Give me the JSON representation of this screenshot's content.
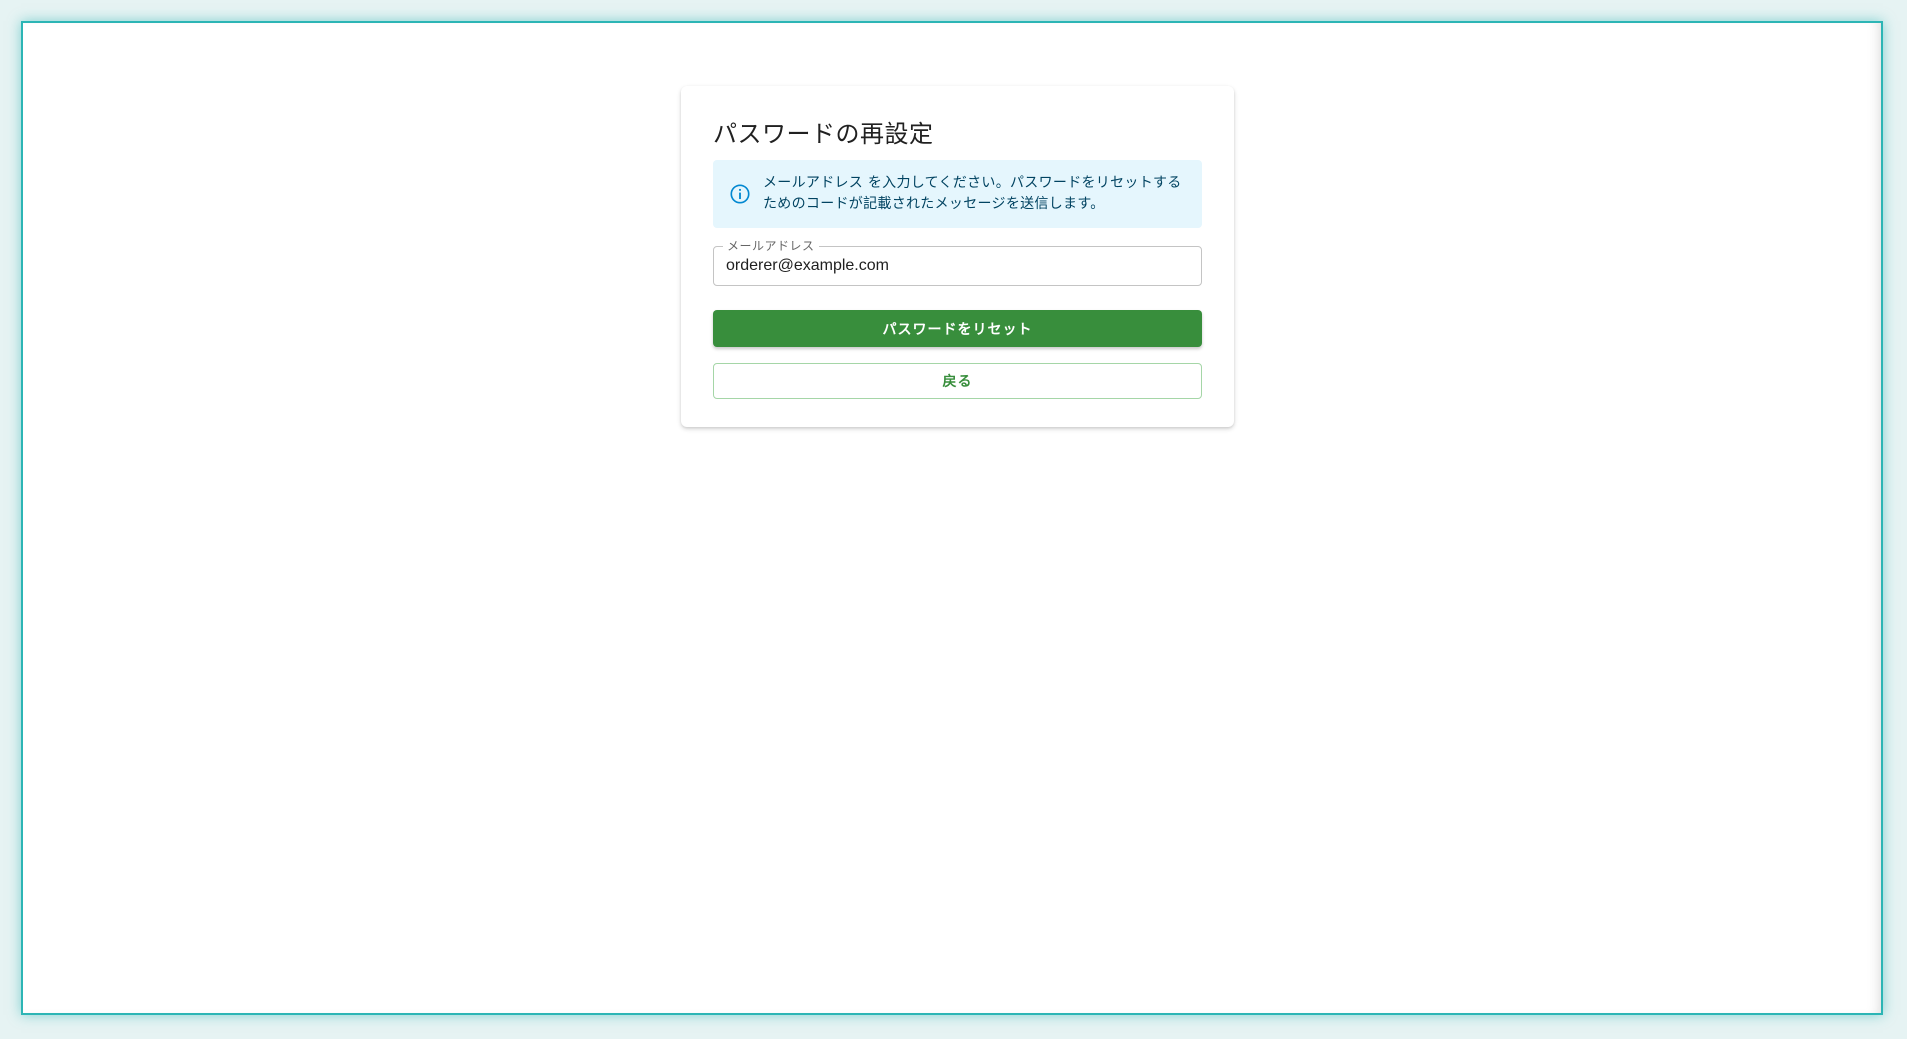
{
  "page": {
    "title": "パスワードの再設定"
  },
  "alert": {
    "icon": "info-icon",
    "message": "メールアドレス を入力してください。パスワードをリセットするためのコードが記載されたメッセージを送信します。"
  },
  "email_field": {
    "label": "メールアドレス",
    "value": "orderer@example.com"
  },
  "buttons": {
    "reset_label": "パスワードをリセット",
    "back_label": "戻る"
  },
  "colors": {
    "primary": "#388e3c",
    "alert_bg": "#e5f6fd",
    "alert_text": "#014361",
    "info_icon": "#0288d1",
    "frame_border": "#2cb5b5"
  }
}
